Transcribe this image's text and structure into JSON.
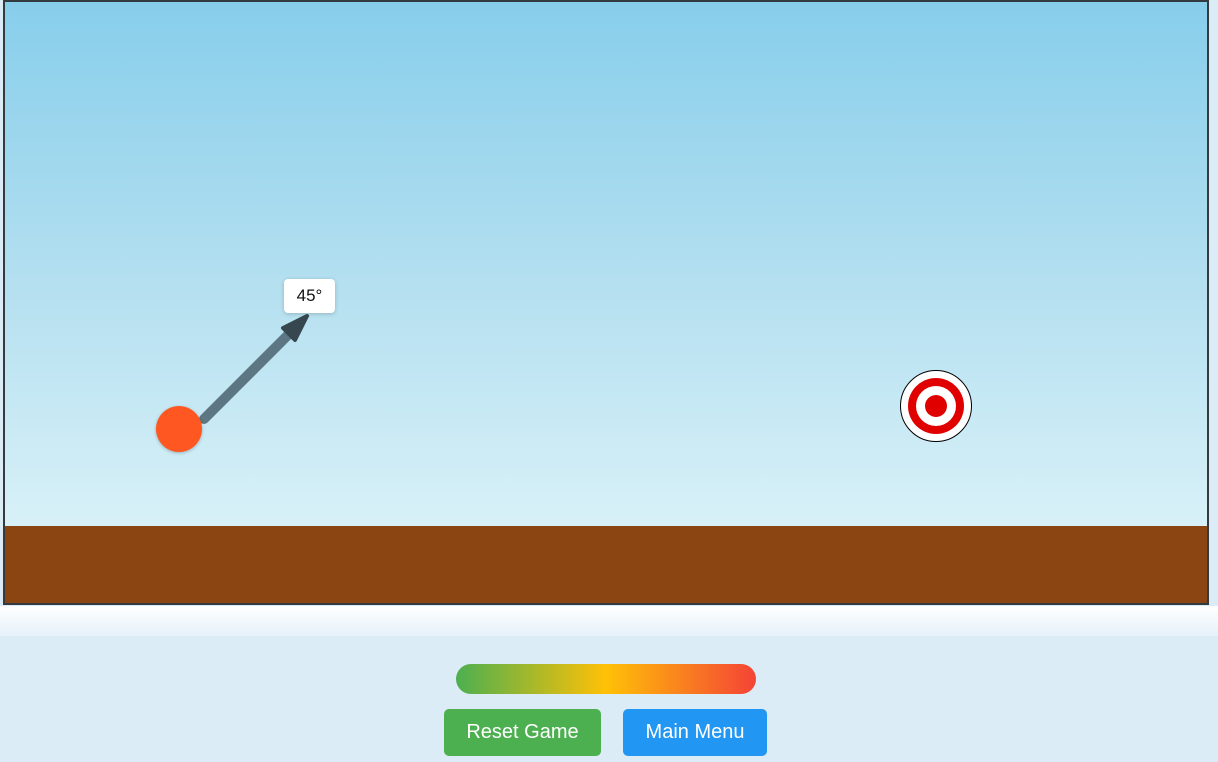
{
  "game": {
    "aim": {
      "angle_label": "45°"
    },
    "colors": {
      "sky_top": "#87ceeb",
      "sky_bottom": "#d8f1f8",
      "ground": "#8b4513",
      "ball": "#ff5722",
      "aim_arrow": "#546e7a",
      "target_red": "#e00000",
      "target_white": "#ffffff"
    }
  },
  "controls": {
    "power_meter": {
      "gradient": [
        "#4caf50",
        "#ffc107",
        "#f44336"
      ]
    },
    "reset_label": "Reset Game",
    "menu_label": "Main Menu"
  }
}
